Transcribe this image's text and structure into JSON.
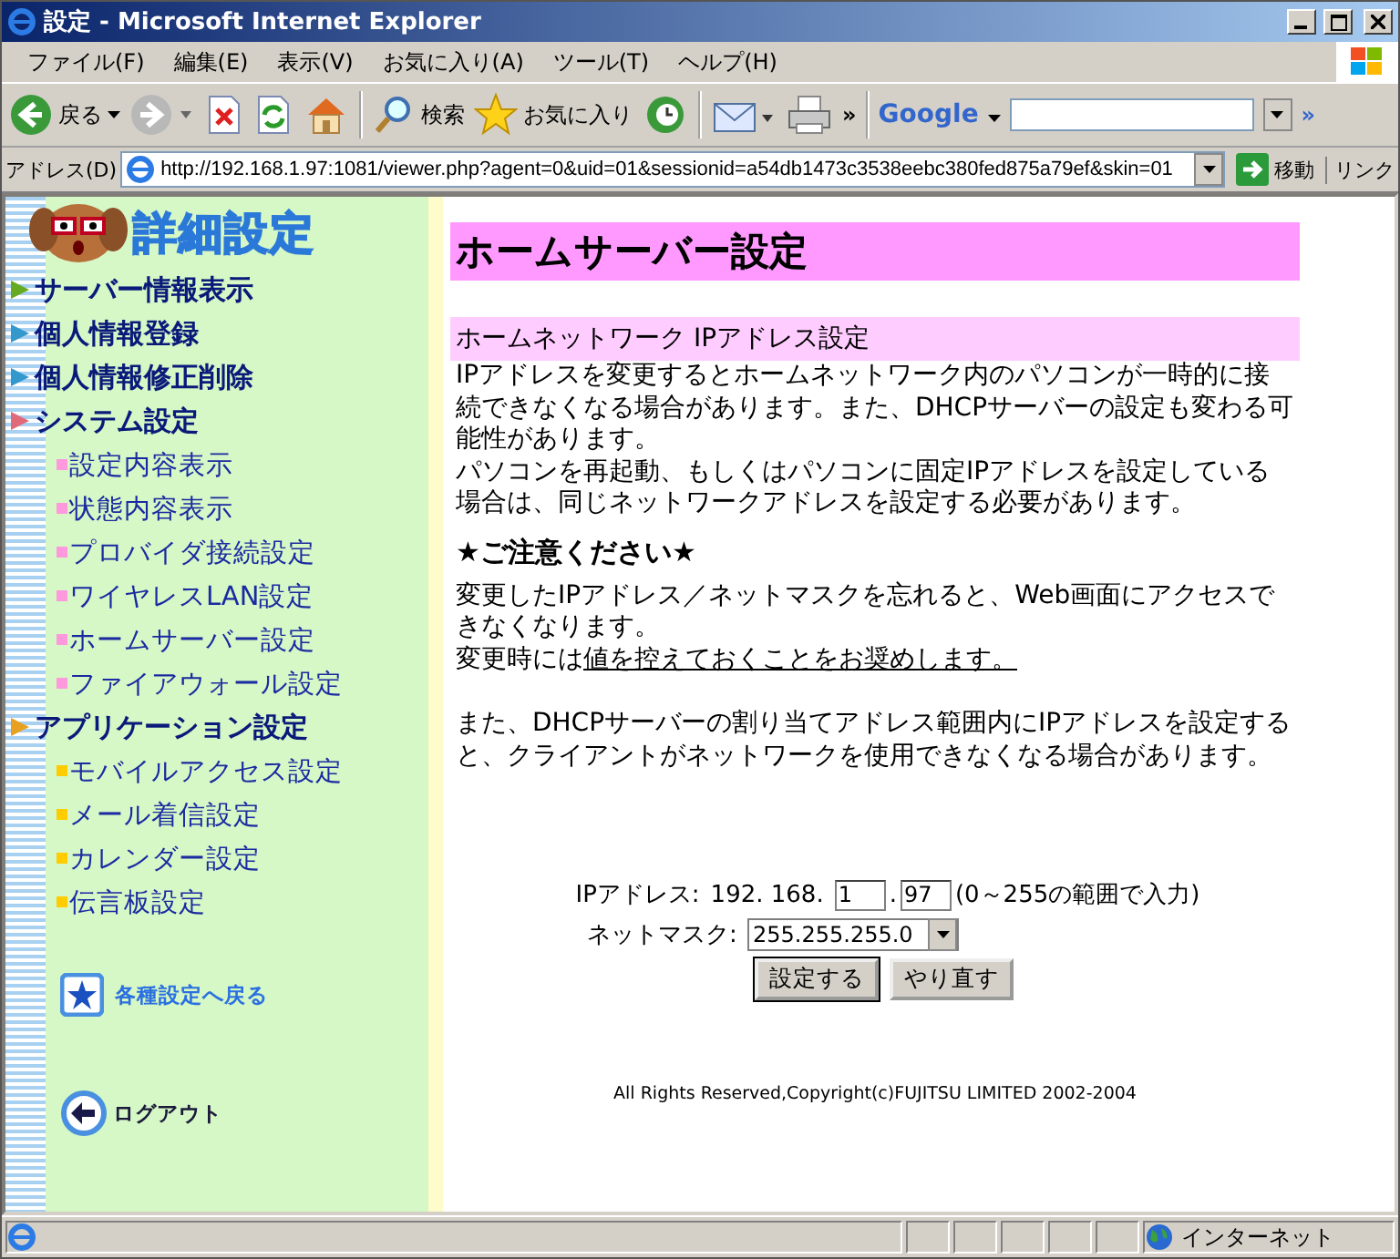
{
  "window": {
    "title": "設定 - Microsoft Internet Explorer"
  },
  "menu": [
    "ファイル(F)",
    "編集(E)",
    "表示(V)",
    "お気に入り(A)",
    "ツール(T)",
    "ヘルプ(H)"
  ],
  "toolbar": {
    "back": "戻る",
    "search": "検索",
    "favorites": "お気に入り",
    "more": "»",
    "google": "Google",
    "google_more": "»"
  },
  "address": {
    "label": "アドレス(D)",
    "url": "http://192.168.1.97:1081/viewer.php?agent=0&uid=01&sessionid=a54db1473c3538eebc380fed875a79ef&skin=01",
    "go": "移動",
    "links": "リンク"
  },
  "sidebar": {
    "header": "詳細設定",
    "nav": [
      {
        "kind": "section",
        "label": "サーバー情報表示",
        "color": "#66aa22"
      },
      {
        "kind": "section",
        "label": "個人情報登録",
        "color": "#3399cc"
      },
      {
        "kind": "section",
        "label": "個人情報修正削除",
        "color": "#3399cc"
      },
      {
        "kind": "section",
        "label": "システム設定",
        "color": "#e06a7a"
      },
      {
        "kind": "item",
        "label": "設定内容表示",
        "color": "#ff99dd"
      },
      {
        "kind": "item",
        "label": "状態内容表示",
        "color": "#ff99dd"
      },
      {
        "kind": "item",
        "label": "プロバイダ接続設定",
        "color": "#ff99dd"
      },
      {
        "kind": "item",
        "label": "ワイヤレスLAN設定",
        "color": "#ff99dd"
      },
      {
        "kind": "item",
        "label": "ホームサーバー設定",
        "color": "#ff99dd"
      },
      {
        "kind": "item",
        "label": "ファイアウォール設定",
        "color": "#ff99dd"
      },
      {
        "kind": "section",
        "label": "アプリケーション設定",
        "color": "#e8a020"
      },
      {
        "kind": "item",
        "label": "モバイルアクセス設定",
        "color": "#ffcc00"
      },
      {
        "kind": "item",
        "label": "メール着信設定",
        "color": "#ffcc00"
      },
      {
        "kind": "item",
        "label": "カレンダー設定",
        "color": "#ffcc00"
      },
      {
        "kind": "item",
        "label": "伝言板設定",
        "color": "#ffcc00"
      }
    ],
    "back_link": "各種設定へ戻る",
    "logout": "ログアウト"
  },
  "main": {
    "title": "ホームサーバー設定",
    "section": "ホームネットワーク IPアドレス設定",
    "intro": [
      "IPアドレスを変更するとホームネットワーク内のパソコンが一時的に接続できなくなる場合があります。また、DHCPサーバーの設定も変わる可能性があります。",
      "パソコンを再起動、もしくはパソコンに固定IPアドレスを設定している場合は、同じネットワークアドレスを設定する必要があります。"
    ],
    "notice_heading": "★ご注意ください★",
    "notice": "変更したIPアドレス／ネットマスクを忘れると、Web画面にアクセスできなくなります。",
    "advice": {
      "prefix": "変更時には",
      "underlined": "値を控えておくことをお奨めします。"
    },
    "dhcp_note": "また、DHCPサーバーの割り当てアドレス範囲内にIPアドレスを設定すると、クライアントがネットワークを使用できなくなる場合があります。",
    "form": {
      "ip_label": "IPアドレス:",
      "ip_prefix": "192. 168.",
      "ip_third": "1",
      "ip_dot": ".",
      "ip_fourth": "97",
      "ip_hint": "(0～255の範囲で入力)",
      "mask_label": "ネットマスク:",
      "mask_value": "255.255.255.0",
      "submit": "設定する",
      "reset": "やり直す"
    },
    "copyright": "All Rights Reserved,Copyright(c)FUJITSU LIMITED 2002-2004"
  },
  "status_bar": {
    "zone": "インターネット"
  }
}
